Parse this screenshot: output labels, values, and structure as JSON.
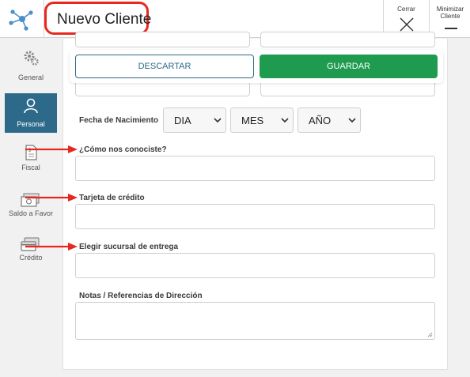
{
  "header": {
    "title": "Nuevo Cliente",
    "close_label": "Cerrar",
    "minimize_label": "Minimizar Cliente"
  },
  "sidebar": {
    "items": [
      {
        "label": "General",
        "icon": "gears-icon"
      },
      {
        "label": "Personal",
        "icon": "user-icon",
        "active": true
      },
      {
        "label": "Fiscal",
        "icon": "document-dollar-icon"
      },
      {
        "label": "Saldo a Favor",
        "icon": "banknote-icon"
      },
      {
        "label": "Crédito",
        "icon": "cards-icon"
      }
    ]
  },
  "actions": {
    "discard_label": "DESCARTAR",
    "save_label": "GUARDAR"
  },
  "form": {
    "birthdate": {
      "label": "Fecha de Nacimiento",
      "day": "DIA",
      "month": "MES",
      "year": "AÑO"
    },
    "referral_label": "¿Cómo nos conociste?",
    "credit_card_label": "Tarjeta de crédito",
    "branch_label": "Elegir sucursal de entrega",
    "notes_label": "Notas / Referencias de Dirección"
  },
  "colors": {
    "accent": "#2d6a8a",
    "save": "#1e9b4f",
    "highlight": "#e8281f"
  }
}
